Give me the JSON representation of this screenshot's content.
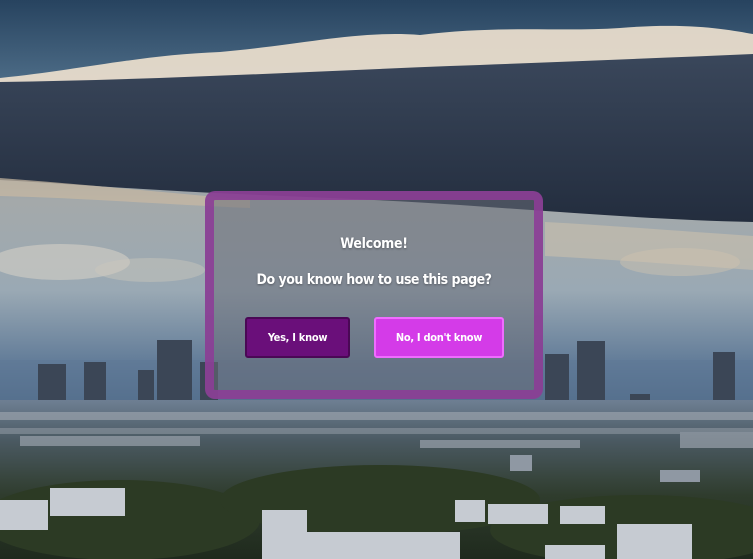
{
  "background": {
    "description_icon": "city-skyline-photo",
    "sky_top": "#2b4560",
    "sky_mid": "#9fb0be",
    "cloud_band": "#2f3a4d",
    "ground": "#2d3a28"
  },
  "modal": {
    "title": "Welcome!",
    "question": "Do you know how to use this page?",
    "border_color": "#8c3c96",
    "yes_button": {
      "label": "Yes, I know",
      "color": "#6a0f7a"
    },
    "no_button": {
      "label": "No, I don't know",
      "color": "#d43be8"
    }
  }
}
